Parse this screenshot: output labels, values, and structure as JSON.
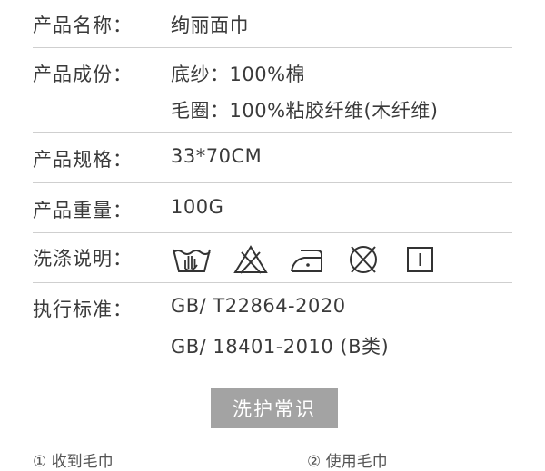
{
  "spec": {
    "name": {
      "label": "产品名称：",
      "value": "绚丽面巾"
    },
    "composition": {
      "label": "产品成份：",
      "line1": "底纱：100%棉",
      "line2": "毛圈：100%粘胶纤维(木纤维)"
    },
    "size": {
      "label": "产品规格：",
      "value": "33*70CM"
    },
    "weight": {
      "label": "产品重量：",
      "value": "100G"
    },
    "care": {
      "label": "洗涤说明：",
      "icons": [
        "hand-wash-icon",
        "do-not-bleach-icon",
        "iron-low-icon",
        "do-not-tumble-dry-icon",
        "line-dry-icon"
      ]
    },
    "standard": {
      "label": "执行标准：",
      "line1": "GB/ T22864-2020",
      "line2": "GB/ 18401-2010 (B类)"
    }
  },
  "care_button": {
    "label": "洗护常识"
  },
  "steps": [
    {
      "label": "① 收到毛巾"
    },
    {
      "label": "② 使用毛巾"
    }
  ],
  "colors": {
    "text": "#3a3a3a",
    "divider": "#cfcfcf",
    "button_bg": "#a3a3a3",
    "button_text": "#ffffff"
  }
}
